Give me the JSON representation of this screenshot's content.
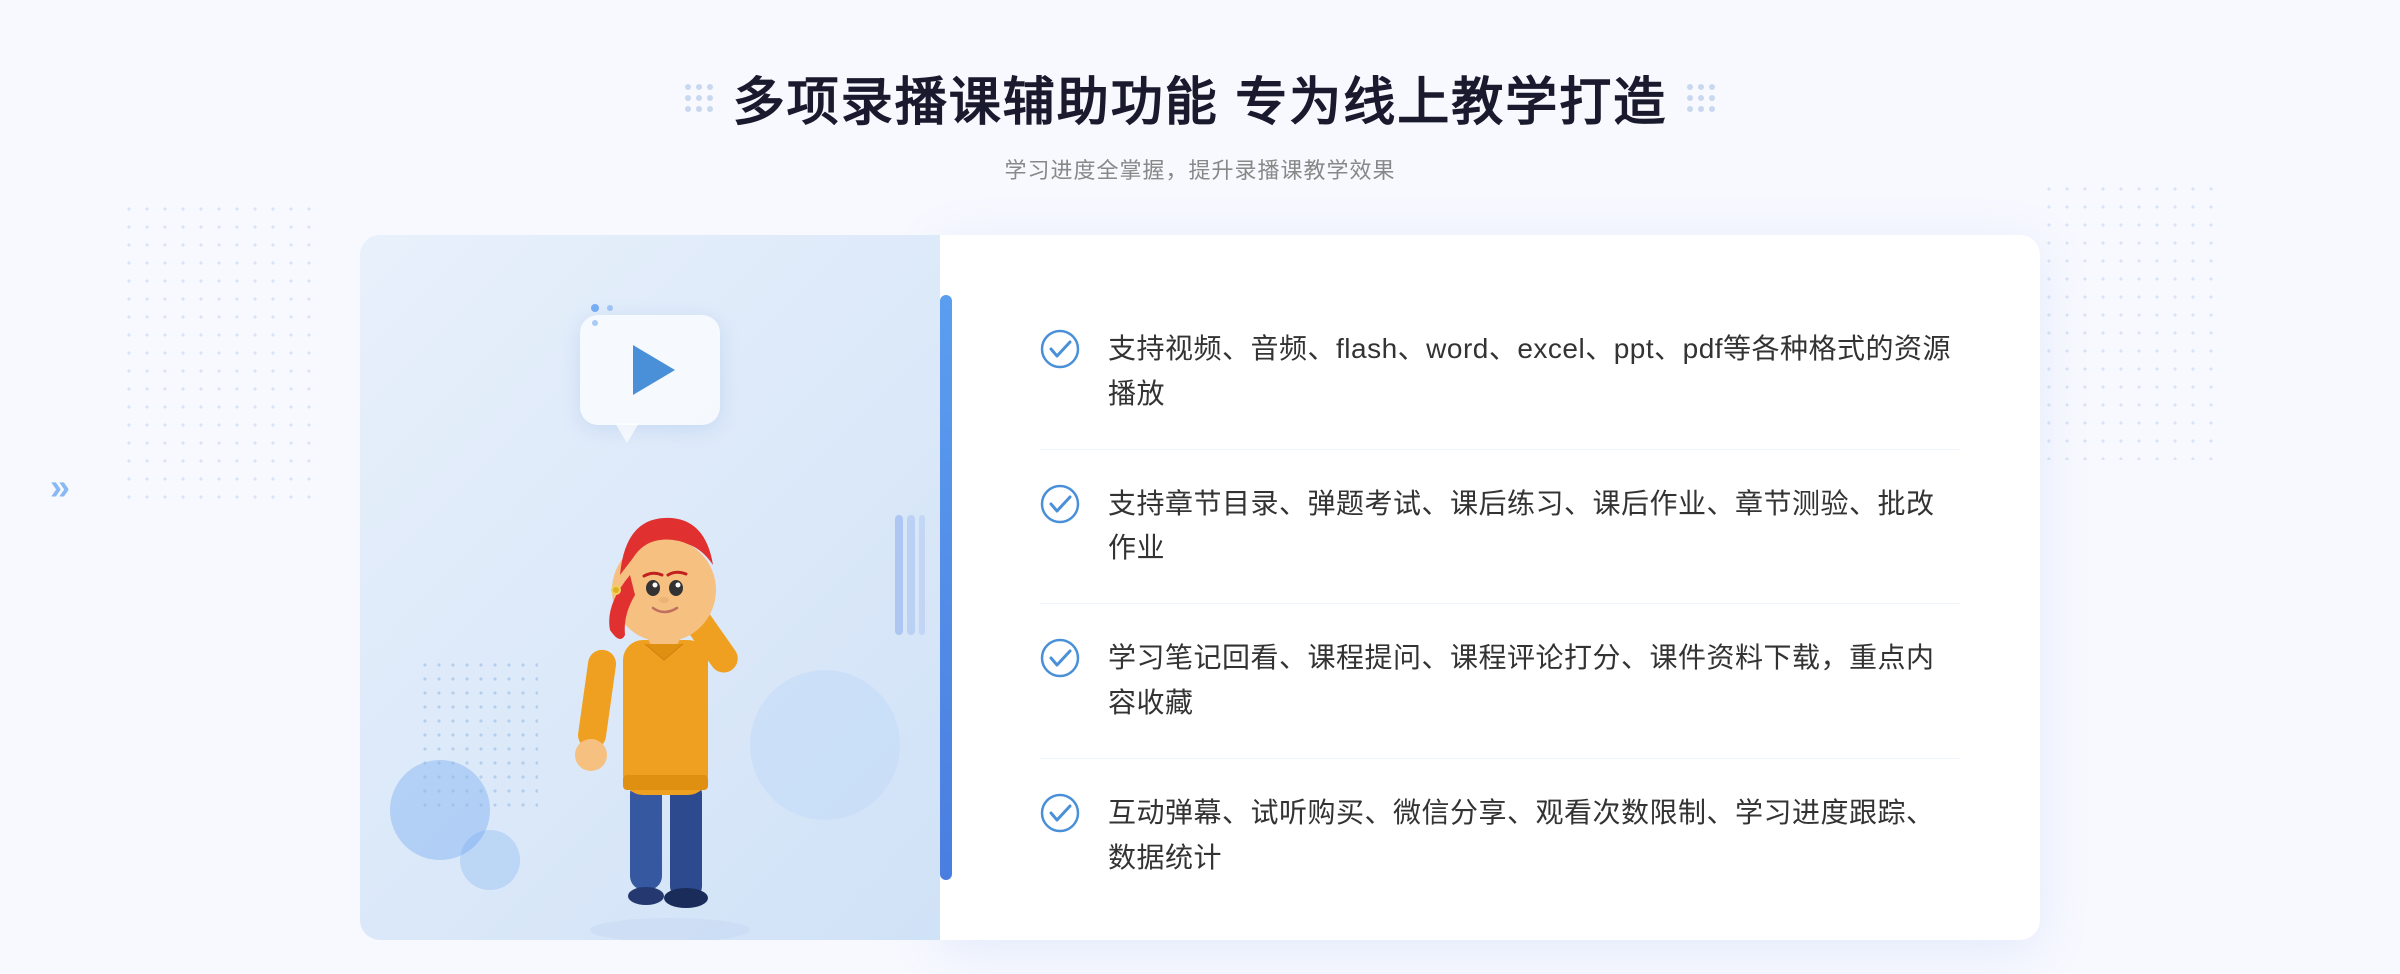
{
  "page": {
    "background_color": "#f8f9ff"
  },
  "header": {
    "title": "多项录播课辅助功能 专为线上教学打造",
    "subtitle": "学习进度全掌握，提升录播课教学效果"
  },
  "features": [
    {
      "id": "feature-1",
      "text": "支持视频、音频、flash、word、excel、ppt、pdf等各种格式的资源播放"
    },
    {
      "id": "feature-2",
      "text": "支持章节目录、弹题考试、课后练习、课后作业、章节测验、批改作业"
    },
    {
      "id": "feature-3",
      "text": "学习笔记回看、课程提问、课程评论打分、课件资料下载，重点内容收藏"
    },
    {
      "id": "feature-4",
      "text": "互动弹幕、试听购买、微信分享、观看次数限制、学习进度跟踪、数据统计"
    }
  ],
  "icons": {
    "check_circle": "✓",
    "play": "▶",
    "arrow_right": "»"
  },
  "colors": {
    "primary": "#4a7de0",
    "primary_light": "#5b9ef0",
    "text_dark": "#1a1a2e",
    "text_medium": "#333333",
    "text_light": "#888888",
    "bg_light": "#f8f9ff",
    "card_bg": "#ffffff",
    "accent_gradient_start": "#e8f0fb",
    "accent_gradient_end": "#d0e2f7"
  }
}
